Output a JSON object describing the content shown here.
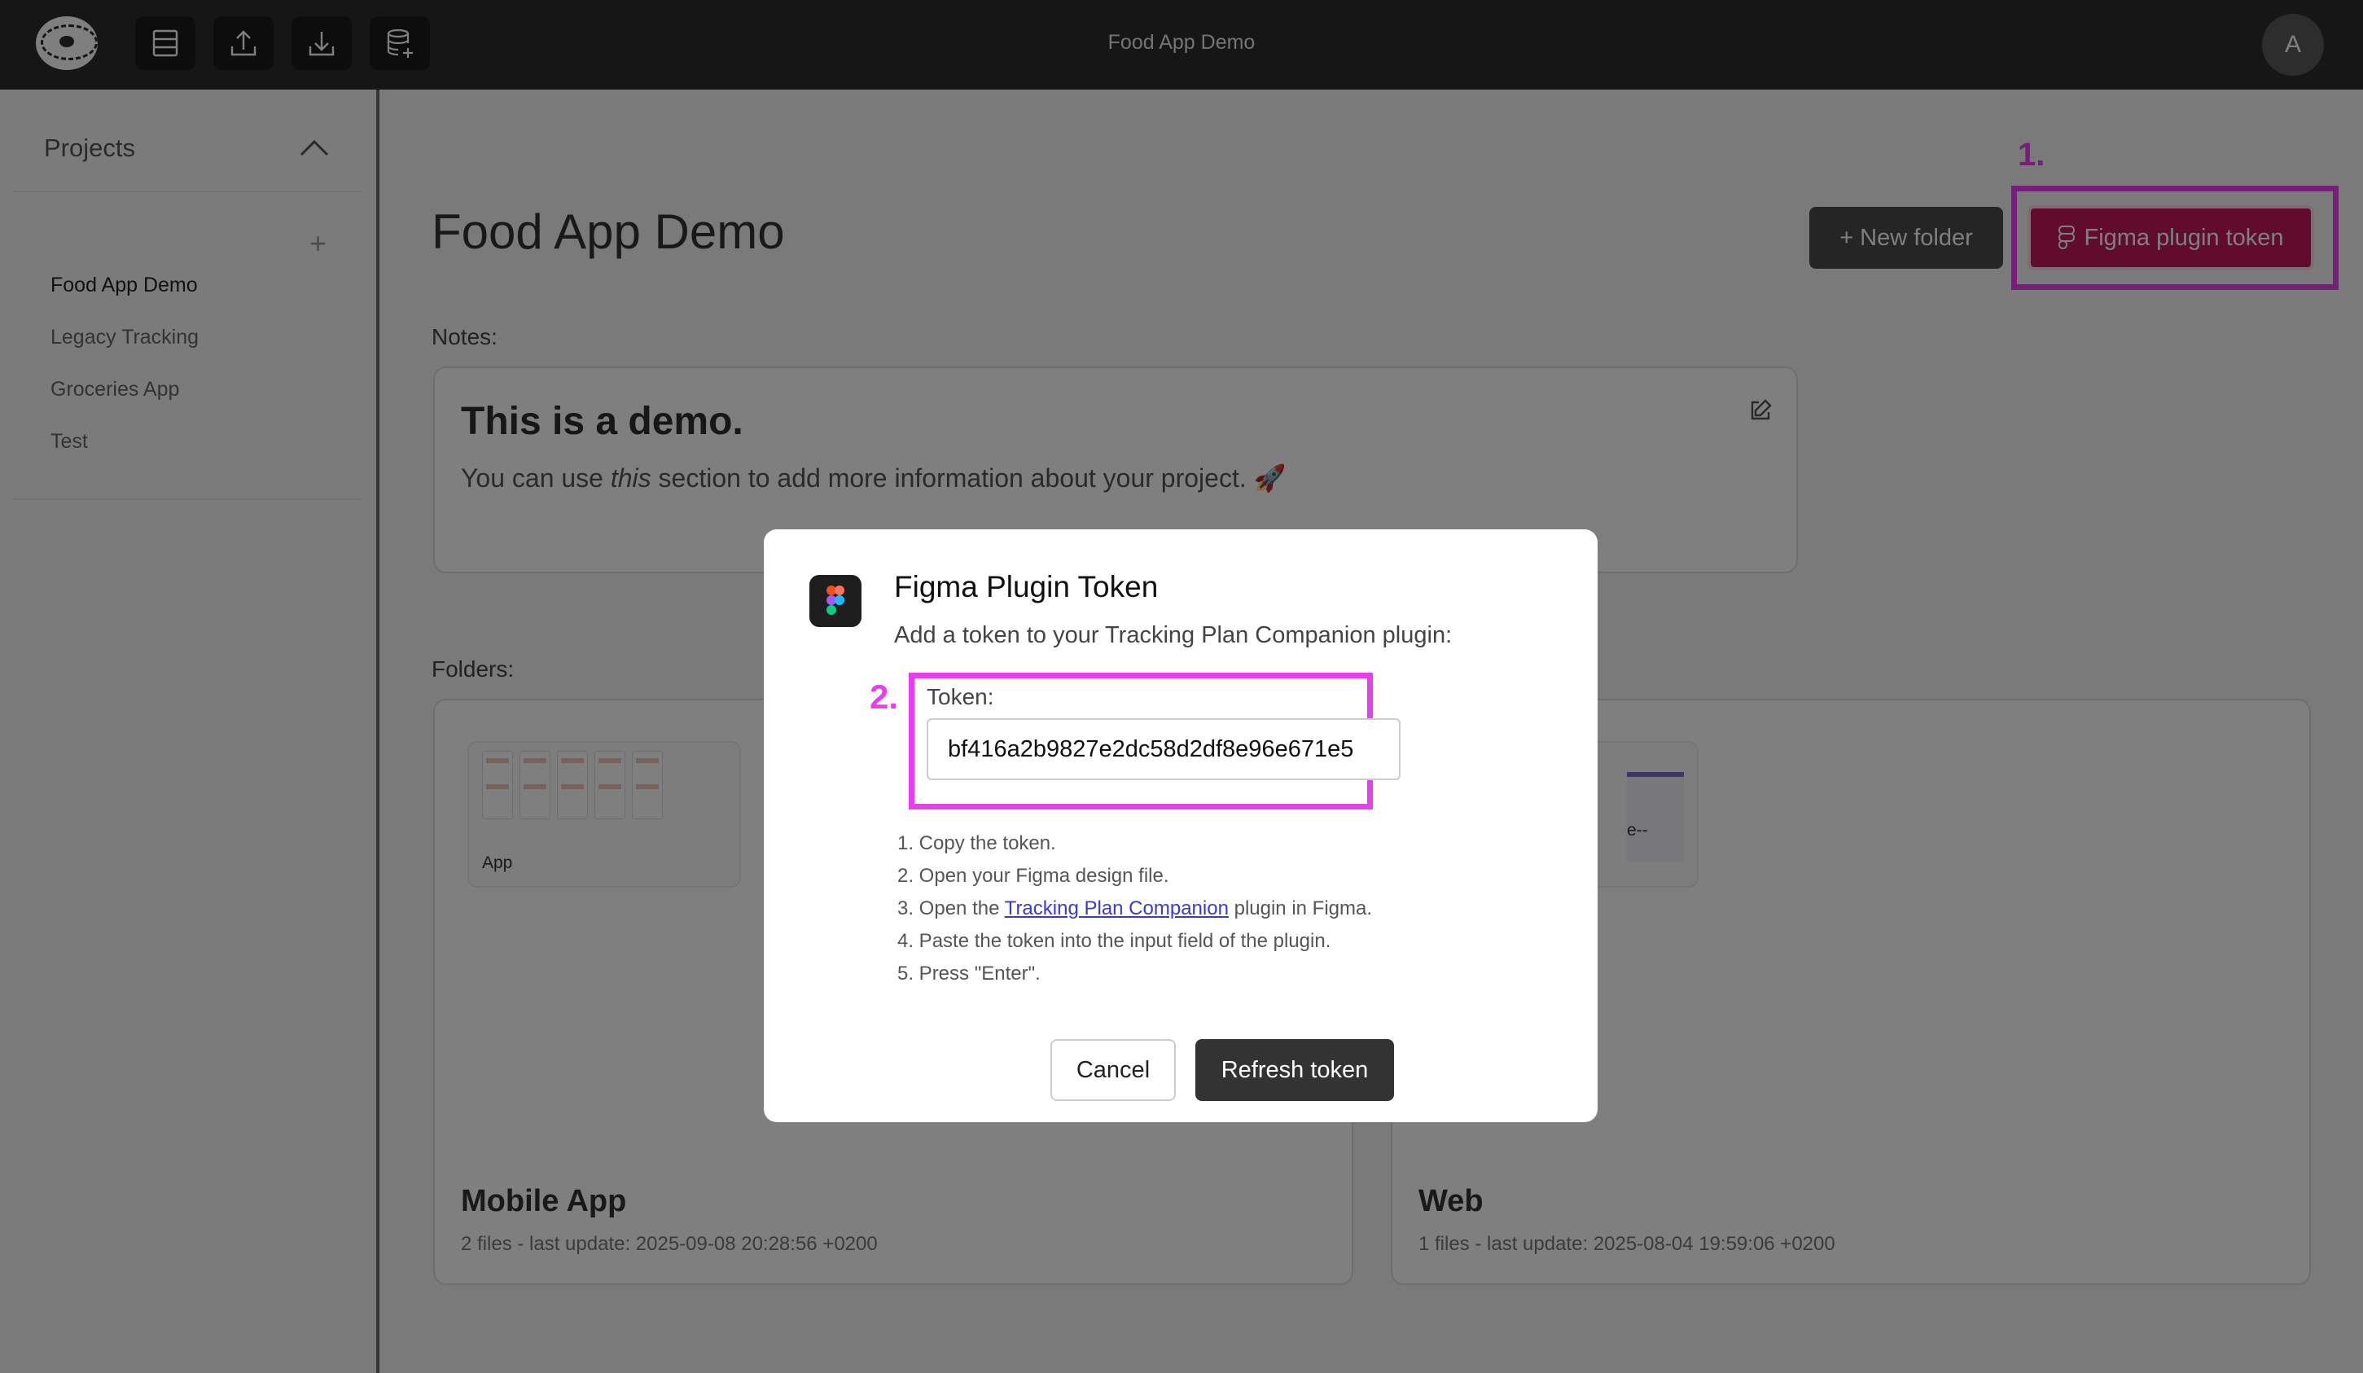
{
  "app": {
    "title": "Food App Demo",
    "avatar_initial": "A"
  },
  "toolbar": {
    "icons": [
      "table-icon",
      "upload-icon",
      "download-icon",
      "database-add-icon"
    ]
  },
  "sidebar": {
    "heading": "Projects",
    "add_symbol": "+",
    "projects": [
      {
        "label": "Food App Demo",
        "active": true
      },
      {
        "label": "Legacy Tracking",
        "active": false
      },
      {
        "label": "Groceries App",
        "active": false
      },
      {
        "label": "Test",
        "active": false
      }
    ]
  },
  "main": {
    "page_title": "Food App Demo",
    "new_folder_label": "+ New folder",
    "figma_token_label": "Figma plugin token",
    "annotation_1": "1.",
    "notes_label": "Notes:",
    "notes": {
      "heading": "This is a demo.",
      "body_before": "You can use ",
      "body_em": "this",
      "body_after": " section to add more information about your project. 🚀"
    },
    "folders_label": "Folders:",
    "folders": [
      {
        "name": "Mobile App",
        "meta": "2 files - last update: 2025-09-08 20:28:56 +0200",
        "thumb_caption": "App"
      },
      {
        "name": "Web",
        "meta": "1 files - last update: 2025-08-04 19:59:06 +0200",
        "thumb_caption": "e--"
      }
    ]
  },
  "modal": {
    "title": "Figma Plugin Token",
    "subtitle": "Add a token to your Tracking Plan Companion plugin:",
    "annotation_2": "2.",
    "token_label": "Token:",
    "token_value": "bf416a2b9827e2dc58d2df8e96e671e5",
    "steps": {
      "s1": "1. Copy the token.",
      "s2": "2. Open your Figma design file.",
      "s3_before": "3. Open the ",
      "s3_link": "Tracking Plan Companion",
      "s3_after": " plugin in Figma.",
      "s4": "4. Paste the token into the input field of the plugin.",
      "s5": "5. Press \"Enter\"."
    },
    "cancel_label": "Cancel",
    "refresh_label": "Refresh token"
  },
  "colors": {
    "topbar": "#2d2d2d",
    "annotation": "#e83ef0",
    "figma_button": "#c2185b",
    "primary_button": "#333333"
  }
}
